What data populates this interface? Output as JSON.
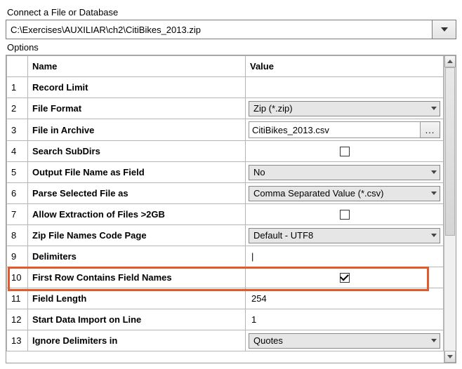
{
  "header_label": "Connect a File or Database",
  "path_value": "C:\\Exercises\\AUXILIAR\\ch2\\CitiBikes_2013.zip",
  "options_label": "Options",
  "columns": {
    "name": "Name",
    "value": "Value"
  },
  "browse_label": "...",
  "rows": [
    {
      "n": "1",
      "name": "Record Limit",
      "type": "empty"
    },
    {
      "n": "2",
      "name": "File Format",
      "type": "select",
      "value": "Zip (*.zip)"
    },
    {
      "n": "3",
      "name": "File in Archive",
      "type": "browse",
      "value": "CitiBikes_2013.csv"
    },
    {
      "n": "4",
      "name": "Search SubDirs",
      "type": "check",
      "checked": false
    },
    {
      "n": "5",
      "name": "Output File Name as Field",
      "type": "select",
      "value": "No"
    },
    {
      "n": "6",
      "name": "Parse Selected File as",
      "type": "select",
      "value": "Comma Separated Value (*.csv)"
    },
    {
      "n": "7",
      "name": "Allow Extraction of Files >2GB",
      "type": "check",
      "checked": false
    },
    {
      "n": "8",
      "name": "Zip File Names Code Page",
      "type": "select",
      "value": "Default - UTF8"
    },
    {
      "n": "9",
      "name": "Delimiters",
      "type": "text",
      "value": "|"
    },
    {
      "n": "10",
      "name": "First Row Contains Field Names",
      "type": "check",
      "checked": true
    },
    {
      "n": "11",
      "name": "Field Length",
      "type": "text",
      "value": "254"
    },
    {
      "n": "12",
      "name": "Start Data Import on Line",
      "type": "text",
      "value": "1"
    },
    {
      "n": "13",
      "name": "Ignore Delimiters in",
      "type": "select",
      "value": "Quotes"
    }
  ],
  "highlight_row": "9"
}
